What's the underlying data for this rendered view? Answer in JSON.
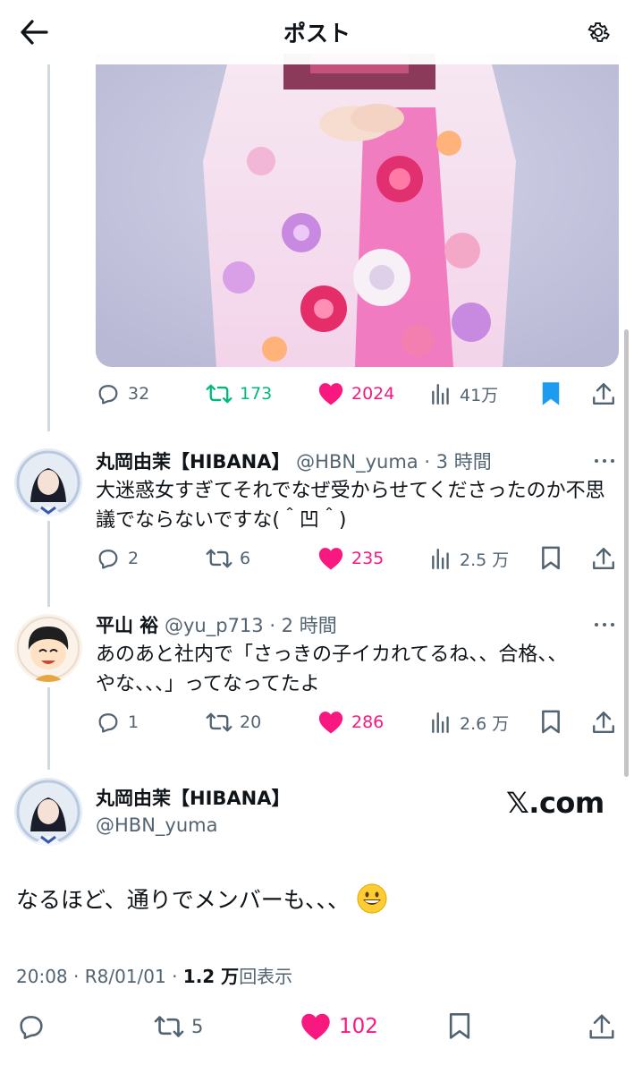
{
  "header": {
    "title": "ポスト",
    "back_icon": "arrow-left-icon",
    "settings_icon": "gear-icon"
  },
  "colors": {
    "like": "#f91880",
    "retweet": "#00ba7c",
    "bookmark_active": "#1d9bf0",
    "muted": "#536471"
  },
  "top_post": {
    "image_icon": "kimono-photo",
    "actions": {
      "replies": "32",
      "retweets": "173",
      "likes": "2024",
      "views": "41万"
    }
  },
  "replies": [
    {
      "name": "丸岡由茉【HIBANA】",
      "meta": "@HBN_yuma · 3 時間",
      "text": "大迷惑女すぎてそれでなぜ受からせてくださったのか不思議でならないですな(＾凹＾)",
      "actions": {
        "replies": "2",
        "retweets": "6",
        "likes": "235",
        "views": "2.5 万"
      }
    },
    {
      "name": "平山 裕",
      "meta": "@yu_p713 · 2 時間",
      "text": "あのあと社内で「さっきの子イカれてるね、、合格、、やな、、、」ってなってたよ",
      "actions": {
        "replies": "1",
        "retweets": "20",
        "likes": "286",
        "views": "2.6 万"
      }
    }
  ],
  "main_post": {
    "name": "丸岡由茉【HIBANA】",
    "handle": "@HBN_yuma",
    "badge": "𝕏.com",
    "text": "なるほど、通りでメンバーも、、、",
    "emoji": "grinning-face",
    "time_date": "20:08 · R8/01/01 · ",
    "views_count": "1.2 万",
    "views_label": "回表示",
    "actions": {
      "retweets": "5",
      "likes": "102"
    }
  }
}
